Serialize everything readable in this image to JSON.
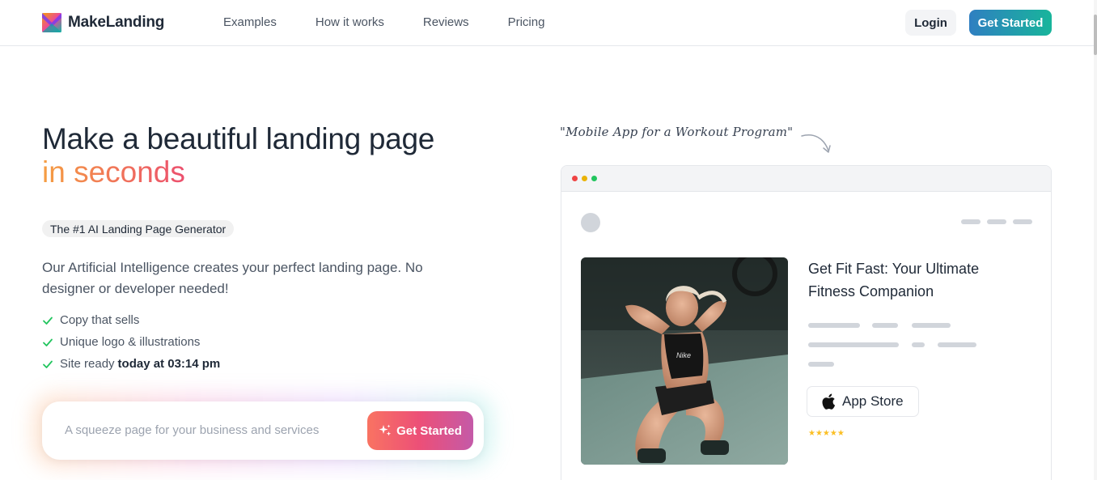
{
  "header": {
    "brand": "MakeLanding",
    "nav": [
      "Examples",
      "How it works",
      "Reviews",
      "Pricing"
    ],
    "login_label": "Login",
    "cta_label": "Get Started"
  },
  "hero": {
    "title": "Make a beautiful landing page",
    "title_accent": "in seconds",
    "badge": "The #1 AI Landing Page Generator",
    "description": "Our Artificial Intelligence creates your perfect landing page. No designer or developer needed!",
    "checks": [
      {
        "text": "Copy that sells",
        "bold": ""
      },
      {
        "text": "Unique logo & illustrations",
        "bold": ""
      },
      {
        "text": "Site ready",
        "bold": "today at 03:14 pm"
      }
    ],
    "prompt_placeholder": "A squeeze page for your business and services",
    "prompt_button": "Get Started"
  },
  "preview": {
    "annotation": "\"Mobile App for a Workout Program\"",
    "headline": "Get Fit Fast: Your Ultimate Fitness Companion",
    "appstore_label": "App Store",
    "stars": "★★★★★",
    "image_brand_text": "Nike"
  },
  "colors": {
    "accent_gradient_start": "#f59e42",
    "accent_gradient_end": "#ec4f6e",
    "cta_gradient_start": "#2f7fc1",
    "cta_gradient_end": "#18b59b",
    "check_green": "#22c55e",
    "star_yellow": "#fbbf24"
  },
  "icons": [
    "logo-icon",
    "check-icon",
    "sparkle-icon",
    "arrow-icon",
    "apple-icon"
  ]
}
